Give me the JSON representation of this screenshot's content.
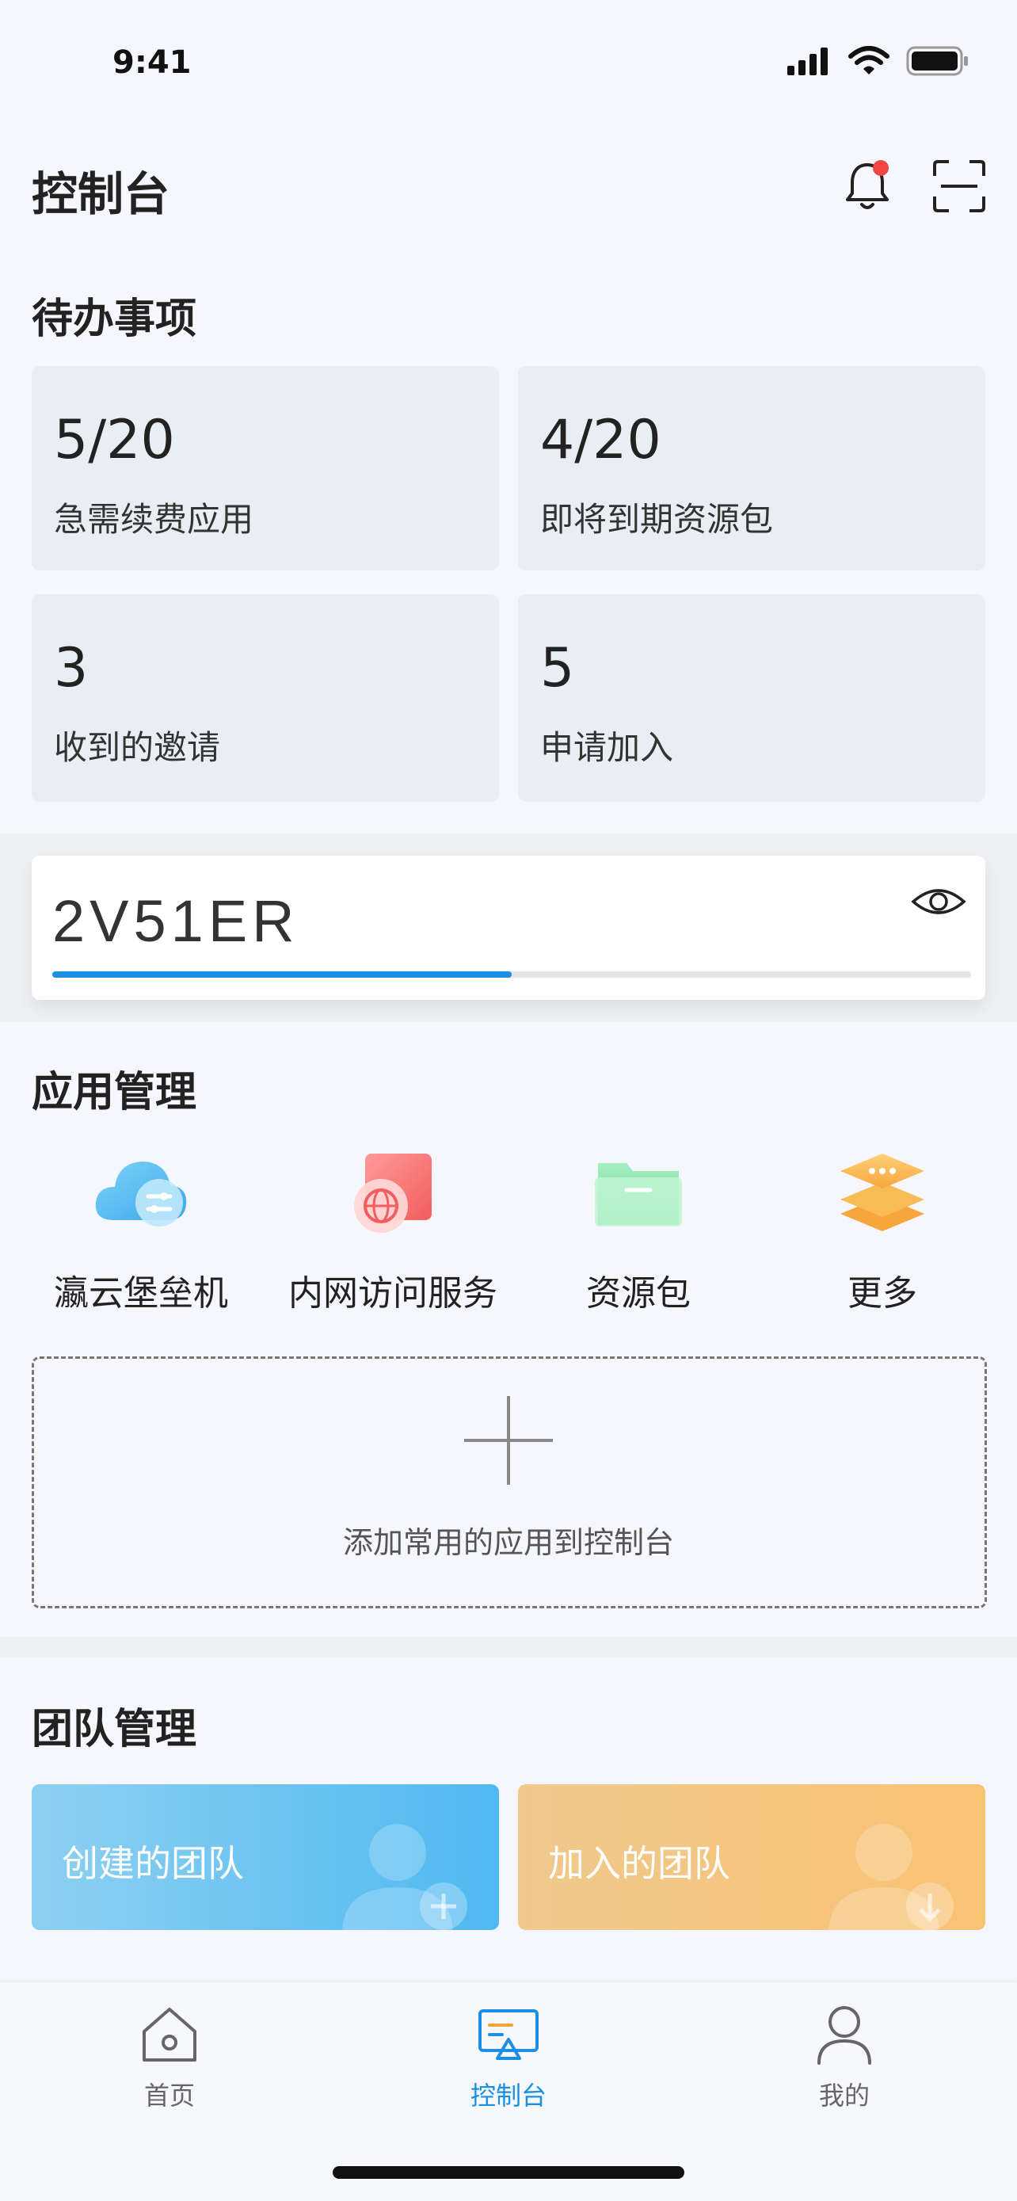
{
  "status_bar": {
    "time": "9:41"
  },
  "header": {
    "title": "控制台",
    "notification_dot_color": "#f04646"
  },
  "todo": {
    "title": "待办事项",
    "cards": [
      {
        "value": "5/20",
        "label": "急需续费应用"
      },
      {
        "value": "4/20",
        "label": "即将到期资源包"
      },
      {
        "value": "3",
        "label": "收到的邀请"
      },
      {
        "value": "5",
        "label": "申请加入"
      }
    ]
  },
  "code_card": {
    "code": "2V51ER",
    "progress": 0.5,
    "progress_color": "#1a8fe3"
  },
  "apps": {
    "title": "应用管理",
    "items": [
      {
        "label": "瀛云堡垒机",
        "icon": "cloud-settings-icon"
      },
      {
        "label": "内网访问服务",
        "icon": "globe-network-icon"
      },
      {
        "label": "资源包",
        "icon": "folder-icon"
      },
      {
        "label": "更多",
        "icon": "layers-more-icon"
      }
    ],
    "add_text": "添加常用的应用到控制台"
  },
  "team": {
    "title": "团队管理",
    "cards": [
      {
        "label": "创建的团队",
        "color": "#62bff0"
      },
      {
        "label": "加入的团队",
        "color": "#f4c57e"
      }
    ]
  },
  "tabbar": {
    "items": [
      {
        "label": "首页",
        "icon": "home-icon",
        "active": false
      },
      {
        "label": "控制台",
        "icon": "console-icon",
        "active": true
      },
      {
        "label": "我的",
        "icon": "user-icon",
        "active": false
      }
    ],
    "active_color": "#1a8fe3"
  }
}
